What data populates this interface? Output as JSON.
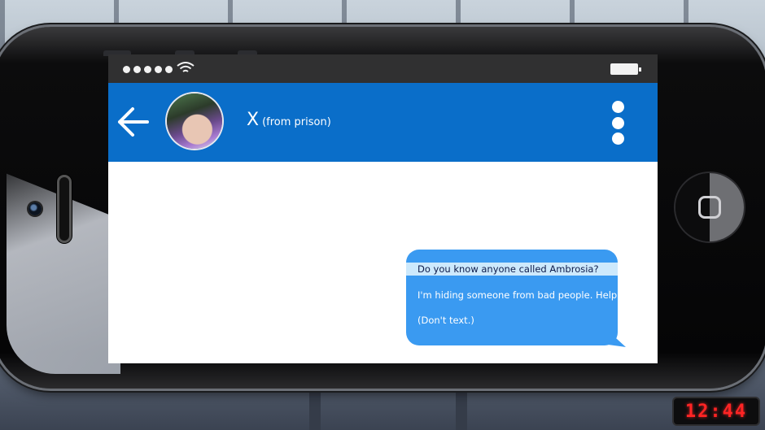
{
  "contact": {
    "name": "X",
    "subtitle": "(from prison)"
  },
  "icons": {
    "back": "arrow-left-icon",
    "menu": "more-vertical-icon",
    "wifi": "wifi-icon",
    "battery": "battery-icon",
    "signal": "signal-dots-icon"
  },
  "messages": [
    {
      "text": "Do you know anyone called Ambrosia?",
      "highlighted": true
    },
    {
      "text": "I'm hiding someone from bad people. Help?",
      "highlighted": false
    },
    {
      "text": "(Don't text.)",
      "highlighted": false
    }
  ],
  "clock": {
    "time": "12:44"
  },
  "colors": {
    "header": "#0a6ec9",
    "status_bar": "#303031",
    "bubble": "#3a9af1",
    "highlight": "#cde9fc",
    "clock_digits": "#ff2424"
  }
}
